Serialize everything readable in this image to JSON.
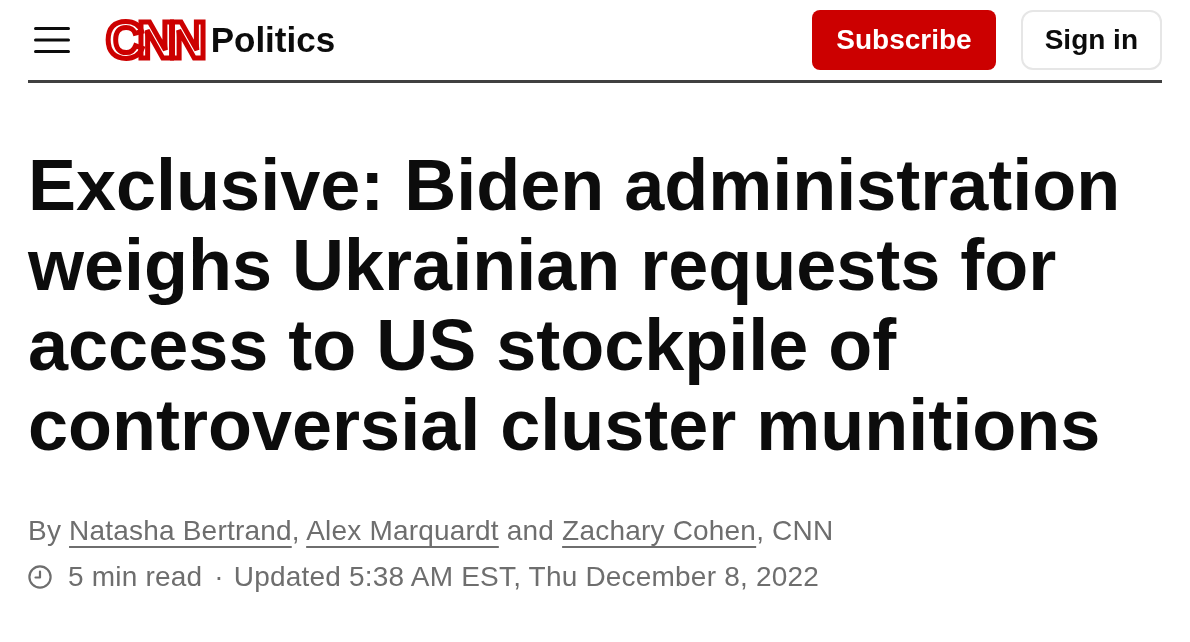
{
  "header": {
    "logo": "CNN",
    "section": "Politics",
    "buttons": [
      {
        "kind": "primary",
        "label": "Subscribe"
      },
      {
        "kind": "secondary",
        "label": "Sign in"
      }
    ]
  },
  "headline": "Exclusive: Biden administration weighs Ukrainian requests for access to US stockpile of controversial cluster munitions",
  "byline": [
    {
      "kind": "text",
      "text": "By "
    },
    {
      "kind": "link",
      "text": "Natasha Bertrand"
    },
    {
      "kind": "text",
      "text": ", "
    },
    {
      "kind": "link",
      "text": "Alex Marquardt"
    },
    {
      "kind": "text",
      "text": " and "
    },
    {
      "kind": "link",
      "text": "Zachary Cohen"
    },
    {
      "kind": "text",
      "text": ", CNN"
    }
  ],
  "meta": {
    "read_time": "5 min read",
    "separator": "·",
    "updated": "Updated 5:38 AM EST, Thu December 8, 2022"
  }
}
